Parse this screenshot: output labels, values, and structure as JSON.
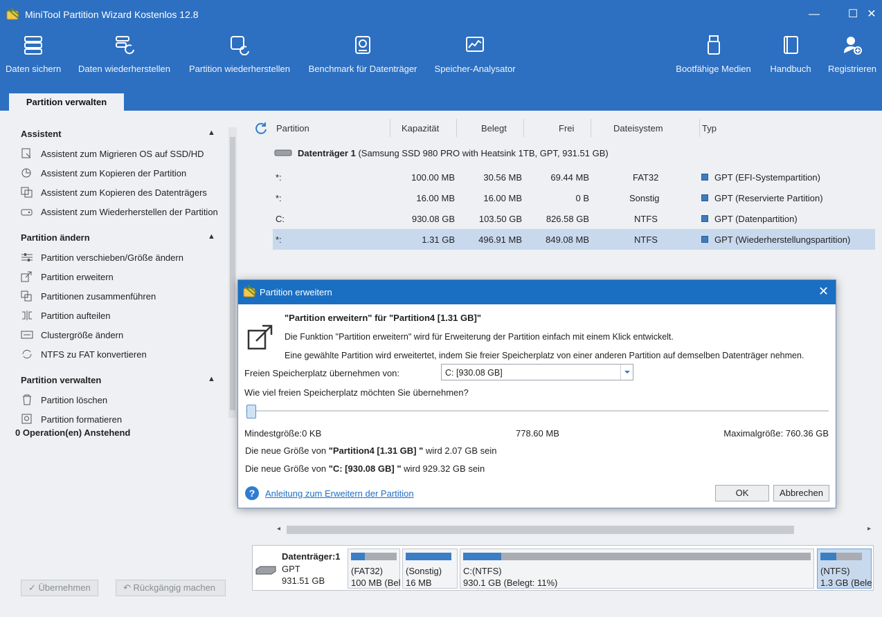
{
  "window": {
    "title": "MiniTool Partition Wizard Kostenlos 12.8",
    "controls": [
      "minimize",
      "maximize",
      "close"
    ]
  },
  "toolbar": {
    "items": [
      {
        "label": "Daten sichern",
        "icon": "backup-icon"
      },
      {
        "label": "Daten wiederherstellen",
        "icon": "data-recovery-icon"
      },
      {
        "label": "Partition wiederherstellen",
        "icon": "partition-recovery-icon"
      },
      {
        "label": "Benchmark für Datenträger",
        "icon": "disk-benchmark-icon"
      },
      {
        "label": "Speicher-Analysator",
        "icon": "space-analyzer-icon"
      },
      {
        "label": "Bootfähige Medien",
        "icon": "bootable-media-icon"
      },
      {
        "label": "Handbuch",
        "icon": "manual-icon"
      },
      {
        "label": "Registrieren",
        "icon": "register-icon"
      }
    ]
  },
  "tabs": {
    "active": "Partition verwalten"
  },
  "sidebar": {
    "sections": [
      {
        "title": "Assistent",
        "items": [
          "Assistent zum Migrieren OS auf SSD/HD",
          "Assistent zum Kopieren der Partition",
          "Assistent zum Kopieren des Datenträgers",
          "Assistent zum Wiederherstellen der Partition"
        ]
      },
      {
        "title": "Partition ändern",
        "items": [
          "Partition verschieben/Größe ändern",
          "Partition erweitern",
          "Partitionen zusammenführen",
          "Partition aufteilen",
          "Clustergröße ändern",
          "NTFS zu FAT konvertieren"
        ]
      },
      {
        "title": "Partition verwalten",
        "items": [
          "Partition löschen",
          "Partition formatieren"
        ]
      }
    ],
    "pending": "0 Operation(en) Anstehend",
    "apply_label": "Übernehmen",
    "undo_label": "Rückgängig machen"
  },
  "table": {
    "headers": [
      "Partition",
      "Kapazität",
      "Belegt",
      "Frei",
      "Dateisystem",
      "Typ"
    ],
    "disk": {
      "name": "Datenträger 1",
      "details": "(Samsung SSD 980 PRO with Heatsink 1TB, GPT, 931.51 GB)"
    },
    "rows": [
      {
        "partition": "*:",
        "capacity": "100.00 MB",
        "used": "30.56 MB",
        "free": "69.44 MB",
        "fs": "FAT32",
        "type": "GPT (EFI-Systempartition)"
      },
      {
        "partition": "*:",
        "capacity": "16.00 MB",
        "used": "16.00 MB",
        "free": "0 B",
        "fs": "Sonstig",
        "type": "GPT (Reservierte Partition)"
      },
      {
        "partition": "C:",
        "capacity": "930.08 GB",
        "used": "103.50 GB",
        "free": "826.58 GB",
        "fs": "NTFS",
        "type": "GPT (Datenpartition)"
      },
      {
        "partition": "*:",
        "capacity": "1.31 GB",
        "used": "496.91 MB",
        "free": "849.08 MB",
        "fs": "NTFS",
        "type": "GPT (Wiederherstellungspartition)"
      }
    ]
  },
  "diskmap": {
    "disk_label": "Datenträger:1",
    "disk_scheme": "GPT",
    "disk_size": "931.51 GB",
    "blocks": [
      {
        "line1": "(FAT32)",
        "line2": "100 MB (Bel",
        "used_fraction": 0.31
      },
      {
        "line1": "(Sonstig)",
        "line2": "16 MB",
        "used_fraction": 1.0
      },
      {
        "line1": "C:(NTFS)",
        "line2": "930.1 GB (Belegt: 11%)",
        "used_fraction": 0.11
      },
      {
        "line1": "(NTFS)",
        "line2": "1.3 GB (Bele",
        "used_fraction": 0.38
      }
    ]
  },
  "dialog": {
    "title": "Partition erweitern",
    "heading": "\"Partition erweitern\" für \"Partition4 [1.31 GB]\"",
    "desc1": "Die Funktion \"Partition erweitern\" wird für Erweiterung der Partition einfach mit einem Klick entwickelt.",
    "desc2": "Eine gewählte Partition wird erweitertet, indem Sie freier Speicherplatz von einer anderen Partition auf demselben Datenträger nehmen.",
    "from_label": "Freien Speicherplatz übernehmen von:",
    "from_value": "C:  [930.08 GB]",
    "question": "Wie viel freien Speicherplatz möchten Sie übernehmen?",
    "slider_value": 0.0,
    "min_label": "Mindestgröße:0 KB",
    "mid_label": "778.60 MB",
    "max_label": "Maximalgröße: 760.36 GB",
    "new1_prefix": "Die neue Größe von ",
    "new1_name": "\"Partition4 [1.31 GB] \"",
    "new1_suffix": " wird 2.07 GB sein",
    "new2_prefix": "Die neue Größe von ",
    "new2_name": "\"C: [930.08 GB] \"",
    "new2_suffix": " wird 929.32 GB sein",
    "help_link": "Anleitung zum Erweitern der Partition",
    "ok_label": "OK",
    "cancel_label": "Abbrechen"
  },
  "colors": {
    "titlebar": "#2d6fc0",
    "dialog_titlebar": "#1a6fc2",
    "selection": "#c8d9ee",
    "partition_used": "#3b7ec4"
  }
}
